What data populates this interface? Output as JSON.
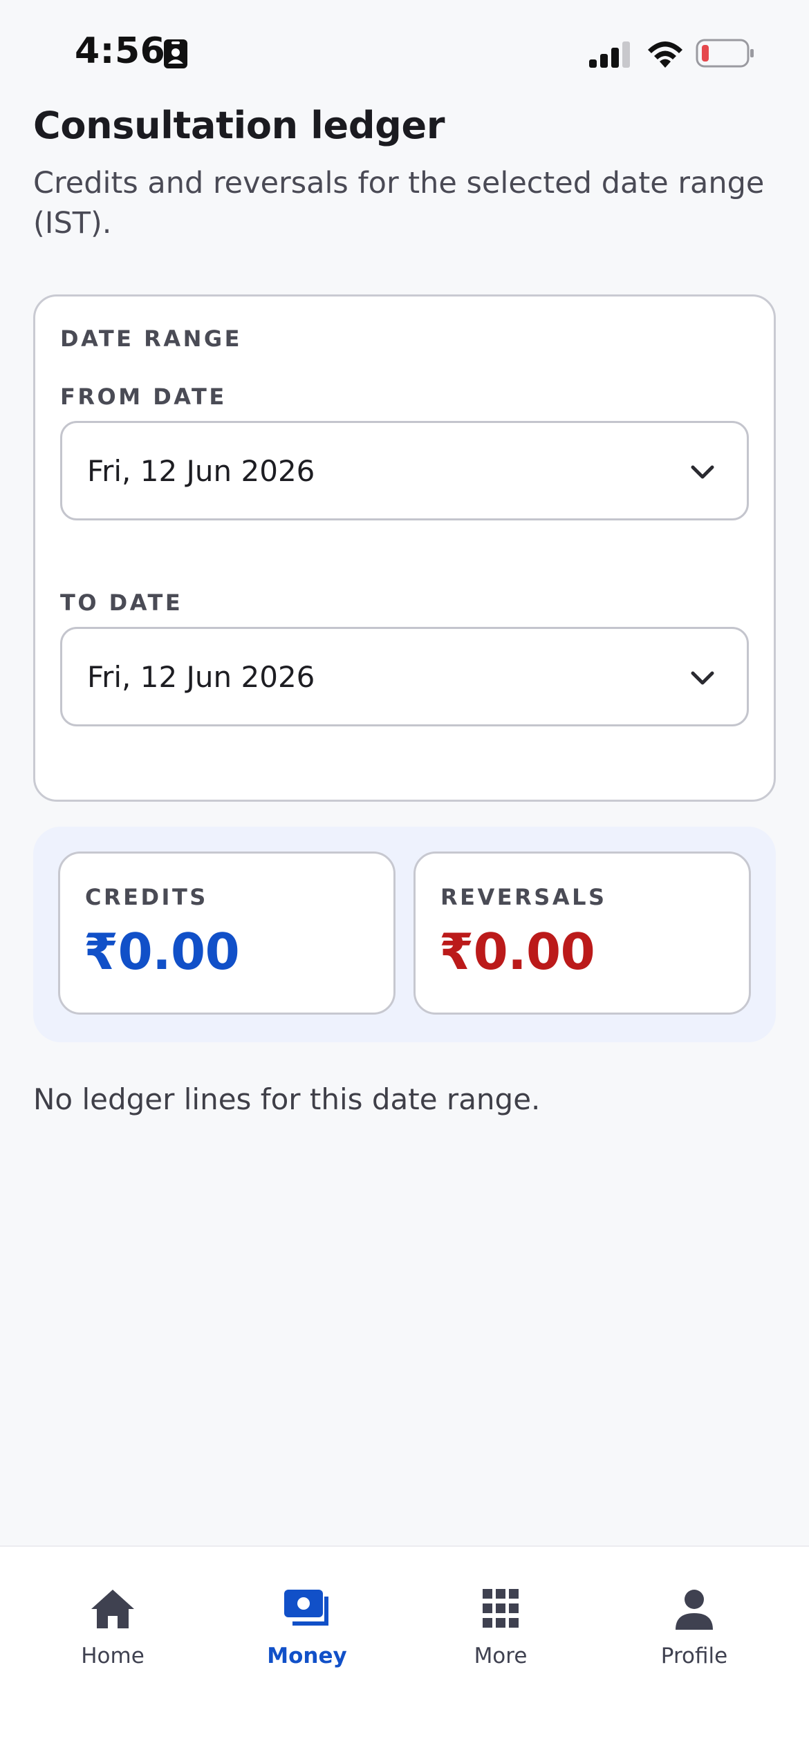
{
  "status_bar": {
    "time": "4:56",
    "battery_color": "#e5484d"
  },
  "header": {
    "title": "Consultation ledger",
    "subtitle": "Credits and reversals for the selected date range (IST)."
  },
  "date_range": {
    "section_label": "DATE RANGE",
    "from_label": "FROM DATE",
    "from_value": "Fri, 12 Jun 2026",
    "to_label": "TO DATE",
    "to_value": "Fri, 12 Jun 2026"
  },
  "totals": {
    "credits_label": "CREDITS",
    "credits_value": "₹0.00",
    "credits_color": "#1150c8",
    "reversals_label": "REVERSALS",
    "reversals_value": "₹0.00",
    "reversals_color": "#bb1a1a"
  },
  "empty_state": "No ledger lines for this date range.",
  "bottom_nav": {
    "items": [
      {
        "label": "Home",
        "icon": "home-icon",
        "active": false
      },
      {
        "label": "Money",
        "icon": "money-icon",
        "active": true
      },
      {
        "label": "More",
        "icon": "grid-icon",
        "active": false
      },
      {
        "label": "Profile",
        "icon": "person-icon",
        "active": false
      }
    ],
    "active_color": "#1150c8",
    "inactive_color": "#3f4150"
  }
}
